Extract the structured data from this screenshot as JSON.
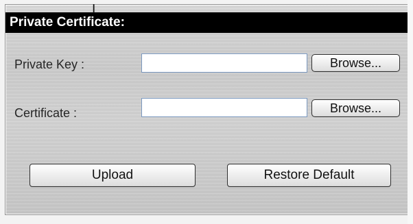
{
  "section": {
    "title": "Private Certificate:"
  },
  "private_key": {
    "label": "Private Key :",
    "value": "",
    "browse_label": "Browse..."
  },
  "certificate": {
    "label": "Certificate :",
    "value": "",
    "browse_label": "Browse..."
  },
  "actions": {
    "upload_label": "Upload",
    "restore_default_label": "Restore Default"
  },
  "icons": {
    "cursor": "text-cursor-icon"
  }
}
